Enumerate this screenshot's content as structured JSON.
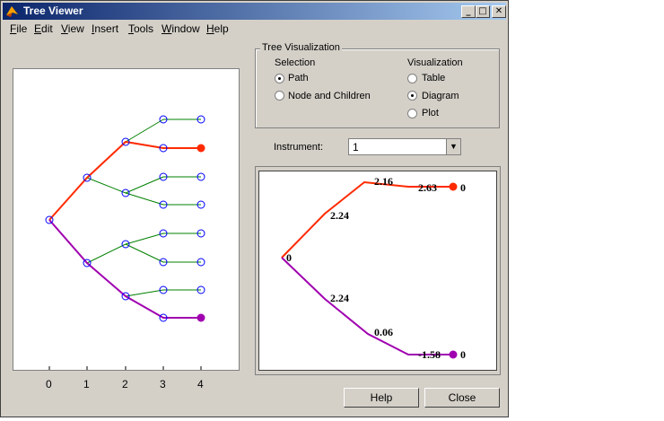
{
  "window": {
    "title": "Tree Viewer"
  },
  "title_buttons": {
    "minimize": "_",
    "maximize": "□",
    "close": "✕"
  },
  "menu": [
    "File",
    "Edit",
    "View",
    "Insert",
    "Tools",
    "Window",
    "Help"
  ],
  "tree_plot": {
    "x_ticks": [
      "0",
      "1",
      "2",
      "3",
      "4"
    ],
    "highlight_color": "#ff2a00",
    "highlight2_color": "#a000b0",
    "branch_color": "#008000",
    "node_color": "#0000ff"
  },
  "tree_visualization": {
    "title": "Tree Visualization",
    "selection": {
      "label": "Selection",
      "options": [
        {
          "label": "Path",
          "selected": true
        },
        {
          "label": "Node and Children",
          "selected": false
        }
      ]
    },
    "visualization": {
      "label": "Visualization",
      "options": [
        {
          "label": "Table",
          "selected": false
        },
        {
          "label": "Diagram",
          "selected": true
        },
        {
          "label": "Plot",
          "selected": false
        }
      ]
    }
  },
  "instrument": {
    "label": "Instrument:",
    "value": "1"
  },
  "diagram": {
    "labels": [
      "0",
      "2.24",
      "2.16",
      "2.63",
      "0",
      "2.24",
      "0.06",
      "-1.58",
      "0"
    ]
  },
  "buttons": {
    "help": "Help",
    "close": "Close"
  }
}
